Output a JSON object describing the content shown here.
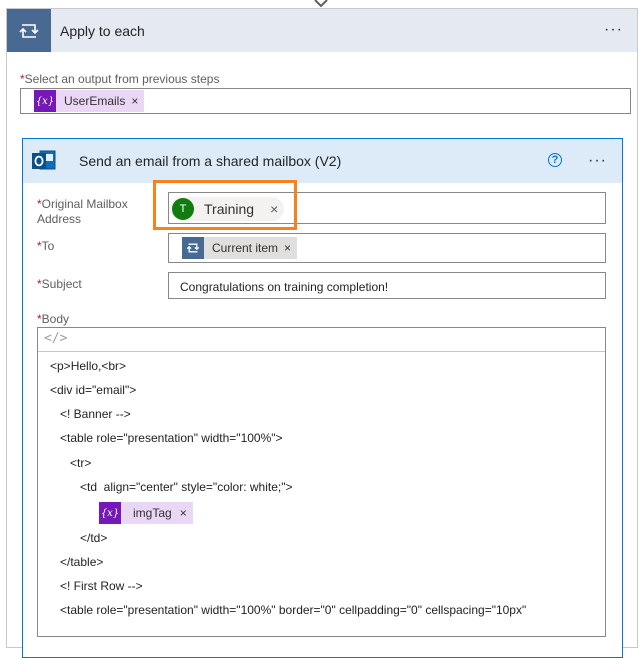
{
  "apply_to_each": {
    "title": "Apply to each",
    "menu_glyph": "···",
    "output_label": "Select an output from previous steps",
    "output_token": {
      "label": "UserEmails",
      "icon": "expression-icon",
      "remove": "×"
    }
  },
  "action": {
    "title": "Send an email from a shared mailbox (V2)",
    "help_glyph": "?",
    "menu_glyph": "···",
    "fields": {
      "mailbox": {
        "label_line1": "Original Mailbox",
        "label_line2": "Address",
        "token_initial": "T",
        "token_label": "Training",
        "remove": "×"
      },
      "to": {
        "label": "To",
        "token_label": "Current item",
        "remove": "×"
      },
      "subject": {
        "label": "Subject",
        "value": "Congratulations on training completion!"
      },
      "body": {
        "label": "Body",
        "code_toggle": "</>",
        "lines": [
          "<p>Hello,<br>",
          "<div id=\"email\">",
          "<! Banner -->",
          "<table role=\"presentation\" width=\"100%\">",
          "<tr>",
          "<td  align=\"center\" style=\"color: white;\">",
          "</td>",
          "</table>",
          "<! First Row -->",
          "<table role=\"presentation\" width=\"100%\" border=\"0\" cellpadding=\"0\" cellspacing=\"10px\""
        ],
        "inline_token": {
          "label": "imgTag",
          "remove": "×"
        }
      }
    }
  },
  "required_marker": "*",
  "colors": {
    "apply_header_bg": "#e4e9f2",
    "apply_icon_bg": "#486991",
    "action_header_bg": "#dcebf7",
    "action_border": "#0078d4",
    "expression_token": "#7419b8",
    "highlight": "#f7821b",
    "avatar": "#107c10"
  }
}
